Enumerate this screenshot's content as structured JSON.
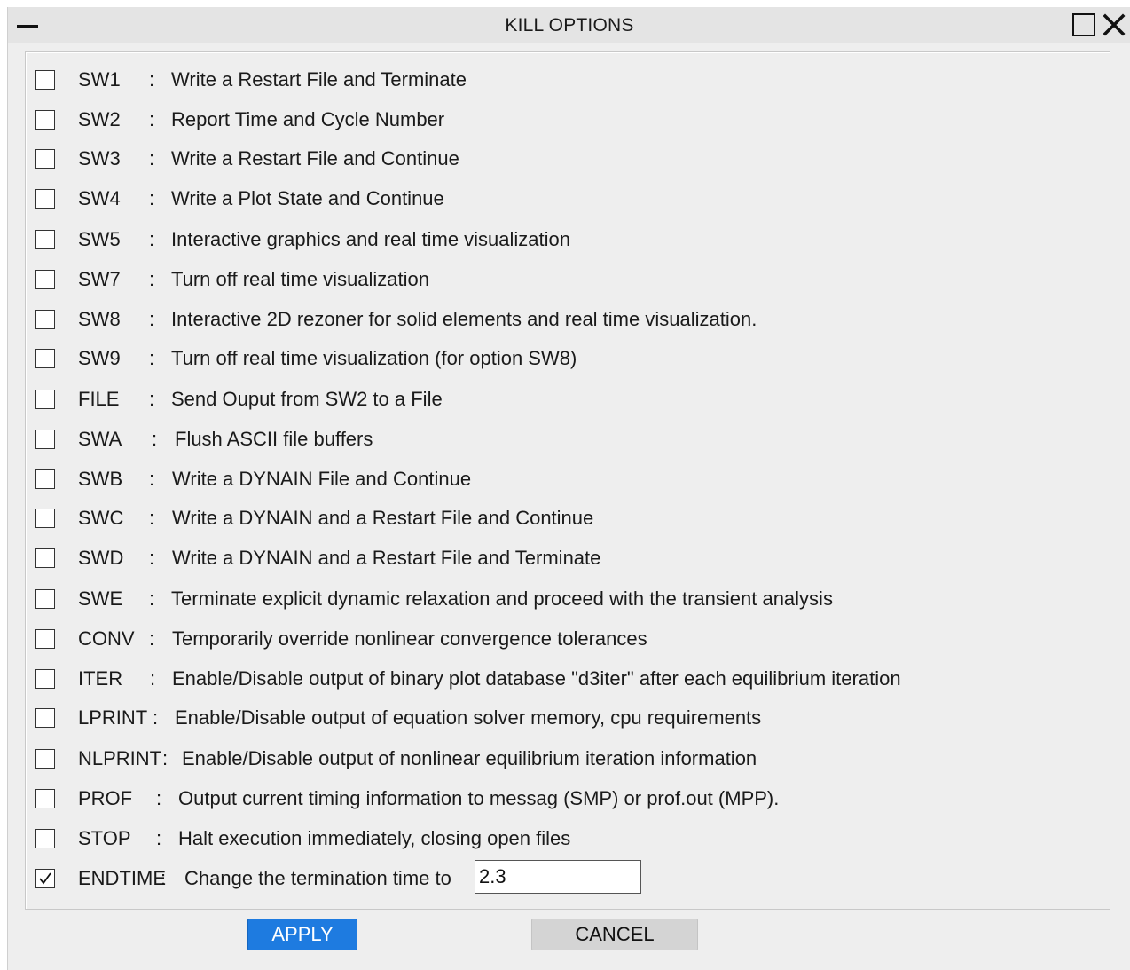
{
  "window": {
    "title": "KILL OPTIONS"
  },
  "options": [
    {
      "code": "SW1",
      "desc": "Write a Restart File and Terminate",
      "checked": false
    },
    {
      "code": "SW2",
      "desc": "Report Time and Cycle Number",
      "checked": false
    },
    {
      "code": "SW3",
      "desc": "Write a Restart File and Continue",
      "checked": false
    },
    {
      "code": "SW4",
      "desc": "Write a Plot State and Continue",
      "checked": false
    },
    {
      "code": "SW5",
      "desc": "Interactive graphics and real time visualization",
      "checked": false
    },
    {
      "code": "SW7",
      "desc": "Turn off real time visualization",
      "checked": false
    },
    {
      "code": "SW8",
      "desc": "Interactive 2D rezoner for solid elements and real time visualization.",
      "checked": false
    },
    {
      "code": "SW9",
      "desc": "Turn off real time visualization (for option SW8)",
      "checked": false
    },
    {
      "code": "FILE",
      "desc": "Send Ouput from SW2 to a File",
      "checked": false
    },
    {
      "code": "SWA",
      "desc": "Flush ASCII file buffers",
      "checked": false
    },
    {
      "code": "SWB",
      "desc": "Write a DYNAIN File and Continue",
      "checked": false
    },
    {
      "code": "SWC",
      "desc": "Write a DYNAIN and a Restart File and Continue",
      "checked": false
    },
    {
      "code": "SWD",
      "desc": "Write a DYNAIN and a Restart File and Terminate",
      "checked": false
    },
    {
      "code": "SWE",
      "desc": "Terminate explicit dynamic relaxation and proceed with the transient analysis",
      "checked": false
    },
    {
      "code": "CONV",
      "desc": "Temporarily override nonlinear convergence tolerances",
      "checked": false
    },
    {
      "code": "ITER",
      "desc": "Enable/Disable output of binary plot database \"d3iter\" after each equilibrium iteration",
      "checked": false
    },
    {
      "code": "LPRINT",
      "desc": "Enable/Disable output of equation solver memory, cpu requirements",
      "checked": false
    },
    {
      "code": "NLPRINT",
      "desc": "Enable/Disable output of nonlinear equilibrium iteration information",
      "checked": false
    },
    {
      "code": "PROF",
      "desc": "Output current timing information to messag (SMP) or prof.out (MPP).",
      "checked": false
    },
    {
      "code": "STOP",
      "desc": "Halt execution immediately, closing open files",
      "checked": false
    },
    {
      "code": "ENDTIME",
      "desc": "Change the termination time to",
      "checked": true
    }
  ],
  "separator": ":",
  "endtime_value": "2.3",
  "buttons": {
    "apply": "APPLY",
    "cancel": "CANCEL"
  },
  "colors": {
    "apply_bg": "#1e7be0",
    "cancel_bg": "#d4d4d4",
    "window_bg": "#eeeeee"
  }
}
